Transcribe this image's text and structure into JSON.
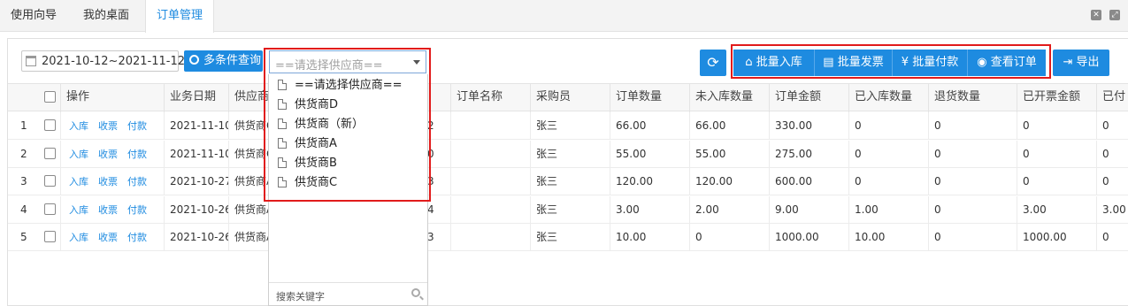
{
  "tabs": [
    "使用向导",
    "我的桌面",
    "订单管理"
  ],
  "toolbar": {
    "date_range": "2021-10-12~2021-11-12",
    "multi_query_label": "多条件查询",
    "supplier_placeholder": "==请选择供应商==",
    "refresh_icon": "refresh-icon",
    "batch_in_label": "批量入库",
    "batch_invoice_label": "批量发票",
    "batch_pay_label": "批量付款",
    "view_order_label": "查看订单",
    "export_label": "导出"
  },
  "supplier_dropdown": {
    "options": [
      "==请选择供应商==",
      "供货商D",
      "供货商（新）",
      "供货商A",
      "供货商B",
      "供货商C"
    ],
    "search_placeholder": "搜索关键字"
  },
  "table": {
    "headers": [
      "操作",
      "业务日期",
      "供应商",
      "订单名称",
      "采购员",
      "订单数量",
      "未入库数量",
      "订单金额",
      "已入库数量",
      "退货数量",
      "已开票金额",
      "已付"
    ],
    "actions": [
      "入库",
      "收票",
      "付款"
    ],
    "rows": [
      {
        "idx": "1",
        "date": "2021-11-10",
        "supplier": "供货商C",
        "code_tail": "2",
        "name": "",
        "buyer": "张三",
        "qty": "66.00",
        "not_in": "66.00",
        "amount": "330.00",
        "in_qty": "0",
        "ret": "0",
        "invoiced": "0",
        "paid": "0"
      },
      {
        "idx": "2",
        "date": "2021-11-10",
        "supplier": "供货商C",
        "code_tail": "0",
        "name": "",
        "buyer": "张三",
        "qty": "55.00",
        "not_in": "55.00",
        "amount": "275.00",
        "in_qty": "0",
        "ret": "0",
        "invoiced": "0",
        "paid": "0"
      },
      {
        "idx": "3",
        "date": "2021-10-27",
        "supplier": "供货商A",
        "code_tail": "3",
        "name": "",
        "buyer": "张三",
        "qty": "120.00",
        "not_in": "120.00",
        "amount": "600.00",
        "in_qty": "0",
        "ret": "0",
        "invoiced": "0",
        "paid": "0"
      },
      {
        "idx": "4",
        "date": "2021-10-26",
        "supplier": "供货商A",
        "code_tail": "4",
        "name": "",
        "buyer": "张三",
        "qty": "3.00",
        "not_in": "2.00",
        "amount": "9.00",
        "in_qty": "1.00",
        "ret": "0",
        "invoiced": "3.00",
        "paid": "3.00"
      },
      {
        "idx": "5",
        "date": "2021-10-26",
        "supplier": "供货商A",
        "code_tail": "3",
        "name": "",
        "buyer": "张三",
        "qty": "10.00",
        "not_in": "0",
        "amount": "1000.00",
        "in_qty": "10.00",
        "ret": "0",
        "invoiced": "1000.00",
        "paid": "0"
      }
    ]
  },
  "colors": {
    "accent": "#1e8be0",
    "highlight": "#e11b1b"
  }
}
